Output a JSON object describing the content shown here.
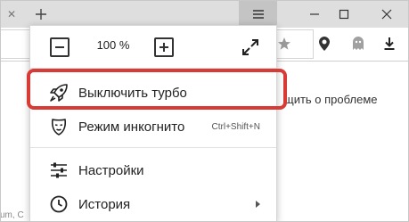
{
  "titlebar": {
    "tab_close_glyph": "✕",
    "new_tab_glyph": "+"
  },
  "page": {
    "report_text": "щить о проблеме",
    "footer_text": "um, C"
  },
  "menu": {
    "zoom_value": "100 %",
    "items": [
      {
        "label": "Выключить турбо",
        "icon": "rocket-icon"
      },
      {
        "label": "Режим инкогнито",
        "shortcut": "Ctrl+Shift+N",
        "icon": "incognito-mask-icon"
      },
      {
        "label": "Настройки",
        "icon": "settings-sliders-icon"
      },
      {
        "label": "История",
        "icon": "history-clock-icon"
      }
    ]
  },
  "colors": {
    "highlight": "#d83a35",
    "titlebar": "#dedede",
    "menu_button_active": "#c4c4c4"
  }
}
